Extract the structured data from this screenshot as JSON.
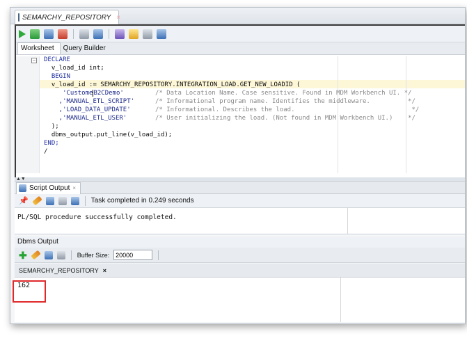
{
  "editor_tab": {
    "title": "SEMARCHY_REPOSITORY",
    "close": "×"
  },
  "worksheet_tabs": [
    "Worksheet",
    "Query Builder"
  ],
  "code_lines": [
    {
      "text": "DECLARE"
    },
    {
      "text": "  v_load_id int;"
    },
    {
      "text": "  BEGIN"
    },
    {
      "text": "  v_load_id := SEMARCHY_REPOSITORY.INTEGRATION_LOAD.GET_NEW_LOADID ("
    },
    {
      "pre": "     'Custome",
      "post": "B2CDemo'",
      "comment": "/* Data Location Name. Case sensitive. Found in MDM Workbench UI. */"
    },
    {
      "text": "    ,'MANUAL_ETL_SCRIPT'",
      "comment": "/* Informational program name. Identifies the middleware.          */"
    },
    {
      "text": "    ,'LOAD_DATA_UPDATE'",
      "comment": "/* Informational. Describes the load.                               */"
    },
    {
      "text": "    ,'MANUAL_ETL_USER'",
      "comment": "/* User initializing the load. (Not found in MDM Workbench UI.)    */"
    },
    {
      "text": "  );"
    },
    {
      "text": "  dbms_output.put_line(v_load_id);"
    },
    {
      "text": "END;"
    },
    {
      "text": "/"
    }
  ],
  "script_output": {
    "tab_label": "Script Output",
    "close": "×",
    "status": "Task completed in 0.249 seconds",
    "message": "PL/SQL procedure successfully completed."
  },
  "dbms_output": {
    "title": "Dbms Output",
    "buffer_label": "Buffer Size:",
    "buffer_value": "20000",
    "connection_tab": "SEMARCHY_REPOSITORY",
    "connection_close": "×",
    "result": "162"
  },
  "colors": {
    "highlight_box": "#e0292b",
    "run_green": "#2eaa3a",
    "keyword": "#1f2f9f"
  }
}
